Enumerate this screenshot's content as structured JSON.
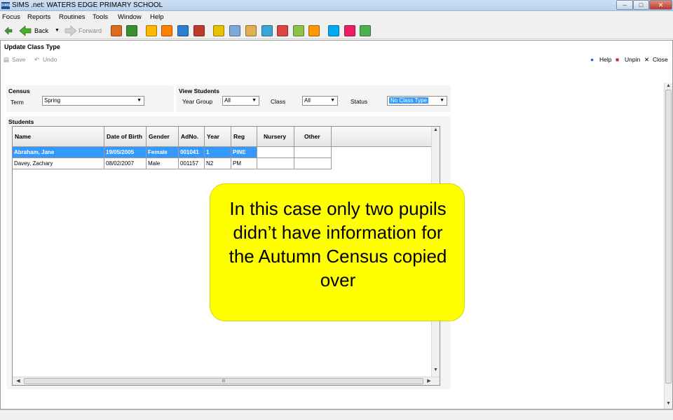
{
  "window": {
    "app_icon_text": "SIMS",
    "title": "SIMS .net: WATERS EDGE PRIMARY SCHOOL",
    "minimize": "–",
    "maximize": "□",
    "close": "✕"
  },
  "menu": [
    "Focus",
    "Reports",
    "Routines",
    "Tools",
    "Window",
    "Help"
  ],
  "toolbar": {
    "back_label": "Back",
    "forward_label": "Forward",
    "icon_colors": [
      "#e06a1b",
      "#3a8f2e",
      "#ffb800",
      "#ff7f00",
      "#2d7fd3",
      "#c0392b",
      "#e8c100",
      "#7fa7d8",
      "#e0b050",
      "#3aa5d6",
      "#d44",
      "#8bc34a",
      "#ff9800",
      "#03a9f4",
      "#e91e63",
      "#4caf50",
      "#9c27b0"
    ]
  },
  "subwindow": {
    "title": "Update Class Type",
    "save_label": "Save",
    "undo_label": "Undo",
    "help_label": "Help",
    "unpin_label": "Unpin",
    "close_label": "Close"
  },
  "census": {
    "title": "Census",
    "term_label": "Term",
    "term_value": "Spring"
  },
  "view_students": {
    "title": "View Students",
    "year_group_label": "Year Group",
    "year_group_value": "All",
    "class_label": "Class",
    "class_value": "All",
    "status_label": "Status",
    "status_value": "No Class Type"
  },
  "students": {
    "title": "Students",
    "columns": [
      "Name",
      "Date of Birth",
      "Gender",
      "AdNo.",
      "Year",
      "Reg",
      "Nursery",
      "Other"
    ],
    "rows": [
      [
        "Abraham, Jane",
        "19/05/2005",
        "Female",
        "001041",
        "1",
        "PINE",
        "",
        ""
      ],
      [
        "Davey, Zachary",
        "08/02/2007",
        "Male",
        "001157",
        "N2",
        "PM",
        "",
        ""
      ]
    ],
    "hscroll_grip": "III"
  },
  "callout": {
    "text": "In this case only two pupils didn’t have information for the Autumn Census copied over"
  }
}
